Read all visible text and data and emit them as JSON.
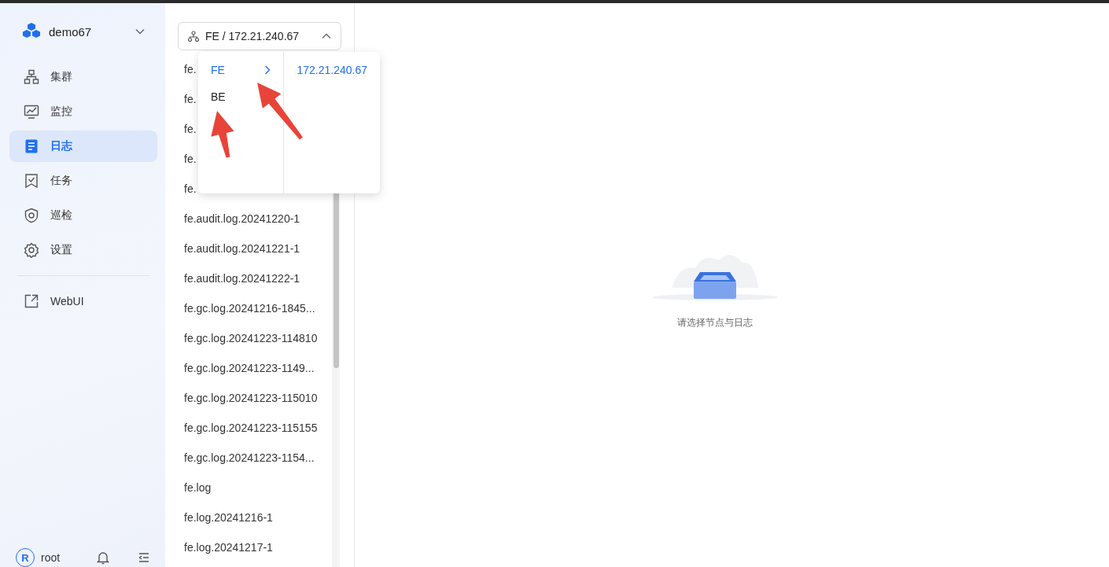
{
  "workspace": {
    "name": "demo67"
  },
  "nav": [
    {
      "label": "集群",
      "kind": "cluster",
      "selected": false
    },
    {
      "label": "监控",
      "kind": "monitor",
      "selected": false
    },
    {
      "label": "日志",
      "kind": "log",
      "selected": true
    },
    {
      "label": "任务",
      "kind": "task",
      "selected": false
    },
    {
      "label": "巡检",
      "kind": "inspect",
      "selected": false
    },
    {
      "label": "设置",
      "kind": "settings",
      "selected": false
    }
  ],
  "external_links": [
    {
      "label": "WebUI"
    }
  ],
  "user": {
    "initial": "R",
    "name": "root"
  },
  "node_selector": {
    "value": "FE / 172.21.240.67",
    "expanded": true
  },
  "cascader": {
    "types": [
      {
        "label": "FE",
        "selected": true
      },
      {
        "label": "BE",
        "selected": false
      }
    ],
    "hosts": [
      {
        "label": "172.21.240.67",
        "selected": true
      }
    ]
  },
  "files": [
    "fe.",
    "fe.",
    "fe.",
    "fe.",
    "fe.",
    "fe.audit.log.20241220-1",
    "fe.audit.log.20241221-1",
    "fe.audit.log.20241222-1",
    "fe.gc.log.20241216-1845...",
    "fe.gc.log.20241223-114810",
    "fe.gc.log.20241223-1149...",
    "fe.gc.log.20241223-115010",
    "fe.gc.log.20241223-115155",
    "fe.gc.log.20241223-1154...",
    "fe.log",
    "fe.log.20241216-1",
    "fe.log.20241217-1"
  ],
  "empty_state": {
    "message": "请选择节点与日志"
  }
}
